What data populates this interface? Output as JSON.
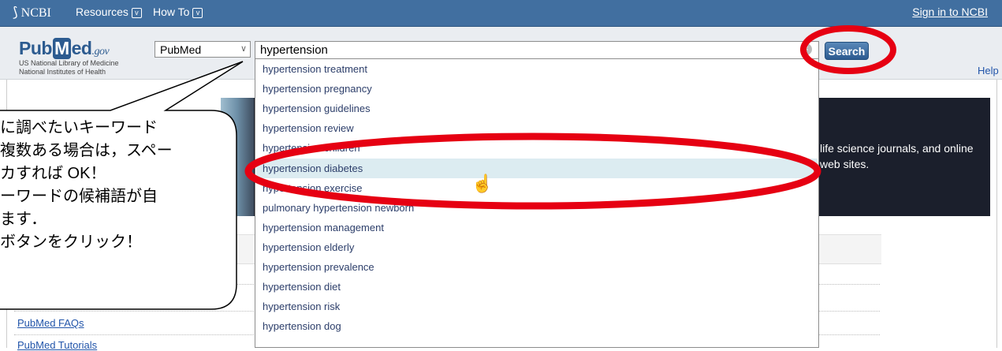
{
  "topbar": {
    "ncbi": "NCBI",
    "resources": "Resources",
    "howto": "How To",
    "signin": "Sign in to NCBI"
  },
  "header": {
    "logo_pub": "Pub",
    "logo_m": "M",
    "logo_ed": "ed",
    "logo_gov": ".gov",
    "lib_line1": "US National Library of Medicine",
    "lib_line2": "National Institutes of Health",
    "db_selected": "PubMed",
    "search_value": "hypertension",
    "search_button": "Search",
    "help": "Help"
  },
  "suggestions": [
    "hypertension treatment",
    "hypertension pregnancy",
    "hypertension guidelines",
    "hypertension review",
    "hypertension children",
    "hypertension diabetes",
    "hypertension exercise",
    "pulmonary hypertension newborn",
    "hypertension management",
    "hypertension elderly",
    "hypertension prevalence",
    "hypertension diet",
    "hypertension risk",
    "hypertension dog"
  ],
  "highlighted_index": 5,
  "banner": {
    "line1": "life science journals, and online",
    "line2": "web sites."
  },
  "links": {
    "faq": "PubMed FAQs",
    "tutorials": "PubMed Tutorials"
  },
  "callout": {
    "line1": "に調べたいキーワード",
    "line2": "複数ある場合は，スペー",
    "line3": "カすれば OK！",
    "line4": "ーワードの候補語が自",
    "line5": "ます．",
    "line6": "ボタンをクリック！"
  },
  "colors": {
    "topbar": "#416fa0",
    "annotation_red": "#e60012",
    "highlight": "#dcecf1"
  }
}
